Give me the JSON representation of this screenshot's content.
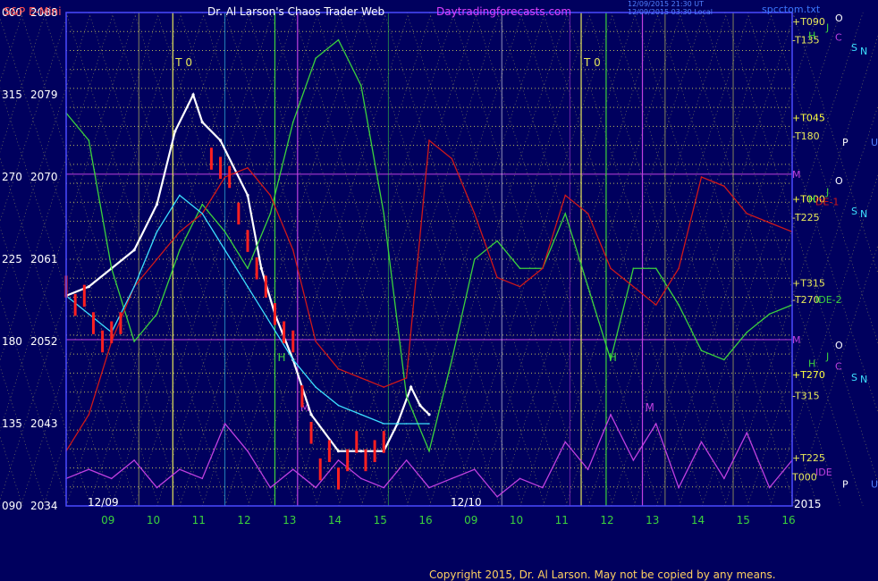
{
  "header": {
    "instrument": "S&P E-Mini",
    "author": "Dr. Al Larson's Chaos Trader Web",
    "site": "Daytradingforecasts.com",
    "timestamp_1": "12/09/2015 21:30 UT",
    "timestamp_2": "12/09/2015 03:30 Local",
    "file": "spcctom.txt"
  },
  "footer": {
    "copyright": "Copyright 2015, Dr. Al Larson. May not be copied by any means."
  },
  "colors": {
    "background": "#00005e",
    "gridline": "#e8e85a",
    "frame": "#4a4aff",
    "price_white": "#ffffff",
    "price_red": "#ff2020",
    "line_green": "#3cd23c",
    "line_red": "#d01818",
    "line_cyan": "#3ce0ff",
    "line_magenta": "#c040e0",
    "axis_text": "#ffffff",
    "title_red": "#ff5050",
    "title_magenta": "#e040ff"
  },
  "chart_data": {
    "type": "line",
    "title": "S&P E-Mini",
    "xlabel": "",
    "ylabel": "",
    "ylim": [
      2034,
      2088
    ],
    "y_ticks": [
      {
        "left": "090",
        "right": "2034",
        "value": 2034
      },
      {
        "left": "135",
        "right": "2043",
        "value": 2043
      },
      {
        "left": "180",
        "right": "2052",
        "value": 2052
      },
      {
        "left": "225",
        "right": "2061",
        "value": 2061
      },
      {
        "left": "270",
        "right": "2070",
        "value": 2070
      },
      {
        "left": "315",
        "right": "2079",
        "value": 2079
      },
      {
        "left": "000",
        "right": "2088",
        "value": 2088
      }
    ],
    "x_ticks": [
      "09",
      "10",
      "11",
      "12",
      "13",
      "14",
      "15",
      "16",
      "09",
      "10",
      "11",
      "12",
      "13",
      "14",
      "15",
      "16"
    ],
    "date_labels": [
      "12/09",
      "12/10"
    ],
    "right_axis_label": "2015",
    "grid": true,
    "series": [
      {
        "name": "price",
        "color": "#ffffff",
        "x": [
          0,
          0.5,
          1,
          1.5,
          2,
          2.4,
          2.8,
          3,
          3.4,
          4,
          4.3,
          4.6,
          5,
          5.4,
          6,
          6.5,
          7,
          7.3,
          7.6,
          7.8,
          8
        ],
        "values": [
          2057,
          2058,
          2060,
          2062,
          2067,
          2075,
          2079,
          2076,
          2074,
          2068,
          2060,
          2055,
          2050,
          2044,
          2040,
          2040,
          2040,
          2043,
          2047,
          2045,
          2044
        ]
      },
      {
        "name": "",
        "color": "#3cd23c",
        "x": [
          0,
          0.5,
          1,
          1.5,
          2,
          2.5,
          3,
          3.5,
          4,
          4.5,
          5,
          5.5,
          6,
          6.5,
          7,
          7.5,
          8,
          8.5,
          9,
          9.5,
          10,
          10.5,
          11,
          11.5,
          12,
          12.5,
          13,
          13.5,
          14,
          14.5,
          15,
          15.5,
          16
        ],
        "values": [
          2077,
          2074,
          2060,
          2052,
          2055,
          2062,
          2067,
          2064,
          2060,
          2066,
          2076,
          2083,
          2085,
          2080,
          2066,
          2046,
          2040,
          2050,
          2061,
          2063,
          2060,
          2060,
          2066,
          2058,
          2050,
          2060,
          2060,
          2056,
          2051,
          2050,
          2053,
          2055,
          2056
        ]
      },
      {
        "name": "",
        "color": "#d01818",
        "x": [
          0,
          0.5,
          1,
          1.5,
          2,
          2.5,
          3,
          3.5,
          4,
          4.5,
          5,
          5.5,
          6,
          6.5,
          7,
          7.5,
          8,
          8.5,
          9,
          9.5,
          10,
          10.5,
          11,
          11.5,
          12,
          12.5,
          13,
          13.5,
          14,
          14.5,
          15,
          15.5,
          16
        ],
        "values": [
          2040,
          2044,
          2052,
          2058,
          2061,
          2064,
          2066,
          2070,
          2071,
          2068,
          2062,
          2052,
          2049,
          2048,
          2047,
          2048,
          2074,
          2072,
          2066,
          2059,
          2058,
          2060,
          2068,
          2066,
          2060,
          2058,
          2056,
          2060,
          2070,
          2069,
          2066,
          2065,
          2064
        ]
      },
      {
        "name": "",
        "color": "#3ce0ff",
        "x": [
          0,
          0.5,
          1,
          1.5,
          2,
          2.5,
          3,
          3.5,
          4,
          4.5,
          5,
          5.5,
          6,
          6.5,
          7,
          7.5,
          8
        ],
        "values": [
          2057,
          2055,
          2053,
          2058,
          2064,
          2068,
          2066,
          2062,
          2058,
          2054,
          2050,
          2047,
          2045,
          2044,
          2043,
          2043,
          2043
        ]
      },
      {
        "name": "",
        "color": "#c040e0",
        "x": [
          0,
          0.5,
          1,
          1.5,
          2,
          2.5,
          3,
          3.5,
          4,
          4.5,
          5,
          5.5,
          6,
          6.5,
          7,
          7.5,
          8,
          8.5,
          9,
          9.5,
          10,
          10.5,
          11,
          11.5,
          12,
          12.5,
          13,
          13.5,
          14,
          14.5,
          15,
          15.5,
          16
        ],
        "values": [
          2037,
          2038,
          2037,
          2039,
          2036,
          2038,
          2037,
          2043,
          2040,
          2036,
          2038,
          2036,
          2039,
          2037,
          2036,
          2039,
          2036,
          2037,
          2038,
          2035,
          2037,
          2036,
          2041,
          2038,
          2044,
          2039,
          2043,
          2036,
          2041,
          2037,
          2042,
          2036,
          2039
        ]
      }
    ],
    "red_bars": {
      "x": [
        0,
        0.2,
        0.4,
        0.6,
        0.8,
        1.0,
        1.2,
        3.2,
        3.4,
        3.6,
        3.8,
        4.0,
        4.2,
        4.4,
        4.6,
        4.8,
        5.0,
        5.2,
        5.4,
        5.6,
        5.8,
        6.0,
        6.2,
        6.4,
        6.6,
        6.8,
        7.0
      ],
      "values": [
        2058,
        2056,
        2057,
        2054,
        2052,
        2053,
        2054,
        2072,
        2071,
        2070,
        2066,
        2063,
        2060,
        2058,
        2055,
        2053,
        2052,
        2046,
        2042,
        2038,
        2040,
        2037,
        2039,
        2041,
        2039,
        2040,
        2041
      ]
    },
    "vertical_markers": [
      {
        "x": 2.35,
        "label": "T 0",
        "color": "#e8e85a"
      },
      {
        "x": 11.35,
        "label": "T 0",
        "color": "#e8e85a"
      },
      {
        "x": 4.6,
        "label": "H",
        "color": "#3cd23c"
      },
      {
        "x": 11.9,
        "label": "H",
        "color": "#3cd23c"
      },
      {
        "x": 5.1,
        "label": "M",
        "color": "#c040e0"
      },
      {
        "x": 12.7,
        "label": "M",
        "color": "#c040e0"
      }
    ],
    "right_labels": [
      {
        "text": "+T090",
        "value": 2087,
        "color": "#e8e85a"
      },
      {
        "text": "-T135",
        "value": 2085,
        "color": "#e8e85a"
      },
      {
        "text": "+T045",
        "value": 2076.5,
        "color": "#ffff40"
      },
      {
        "text": "-T180",
        "value": 2074.5,
        "color": "#e8e85a"
      },
      {
        "text": "M",
        "value": 2070.3,
        "color": "#c040e0"
      },
      {
        "text": "+T000",
        "value": 2067.6,
        "color": "#ffff40"
      },
      {
        "text": "DE-1",
        "value": 2067.3,
        "color": "#d01818"
      },
      {
        "text": "-T225",
        "value": 2065.6,
        "color": "#e8e85a"
      },
      {
        "text": "+T315",
        "value": 2058.4,
        "color": "#e8e85a"
      },
      {
        "text": "-T270",
        "value": 2056.6,
        "color": "#e8e85a"
      },
      {
        "text": "IDE-2",
        "value": 2056.6,
        "color": "#3cd23c"
      },
      {
        "text": "M",
        "value": 2052.2,
        "color": "#c040e0"
      },
      {
        "text": "+T270",
        "value": 2048.4,
        "color": "#ffff40"
      },
      {
        "text": "-T315",
        "value": 2046.1,
        "color": "#e8e85a"
      },
      {
        "text": "+T225",
        "value": 2039.3,
        "color": "#e8e85a"
      },
      {
        "text": "T000",
        "value": 2037.2,
        "color": "#e8e85a"
      },
      {
        "text": "IDE",
        "value": 2037.7,
        "color": "#c040e0"
      }
    ],
    "planet_labels": [
      {
        "text": "O",
        "value": 2087.4,
        "color": "#ffffff"
      },
      {
        "text": "H",
        "value": 2085.5,
        "color": "#3cd23c"
      },
      {
        "text": "J",
        "value": 2086.4,
        "color": "#3cd23c"
      },
      {
        "text": "C",
        "value": 2085.3,
        "color": "#c040e0"
      },
      {
        "text": "S",
        "value": 2084.2,
        "color": "#3ce0ff"
      },
      {
        "text": "N",
        "value": 2083.8,
        "color": "#3ce0ff"
      },
      {
        "text": "P",
        "value": 2073.8,
        "color": "#ffffff"
      },
      {
        "text": "U",
        "value": 2073.8,
        "color": "#5080ff"
      },
      {
        "text": "O",
        "value": 2069.6,
        "color": "#ffffff"
      },
      {
        "text": "H",
        "value": 2067.6,
        "color": "#3cd23c"
      },
      {
        "text": "J",
        "value": 2068.4,
        "color": "#3cd23c"
      },
      {
        "text": "S",
        "value": 2066.3,
        "color": "#3ce0ff"
      },
      {
        "text": "N",
        "value": 2066,
        "color": "#3ce0ff"
      },
      {
        "text": "O",
        "value": 2051.6,
        "color": "#ffffff"
      },
      {
        "text": "H",
        "value": 2049.6,
        "color": "#3cd23c"
      },
      {
        "text": "J",
        "value": 2050.4,
        "color": "#3cd23c"
      },
      {
        "text": "C",
        "value": 2049.3,
        "color": "#c040e0"
      },
      {
        "text": "S",
        "value": 2048.1,
        "color": "#3ce0ff"
      },
      {
        "text": "N",
        "value": 2047.9,
        "color": "#3ce0ff"
      },
      {
        "text": "P",
        "value": 2036.4,
        "color": "#ffffff"
      },
      {
        "text": "U",
        "value": 2036.4,
        "color": "#5080ff"
      }
    ]
  }
}
